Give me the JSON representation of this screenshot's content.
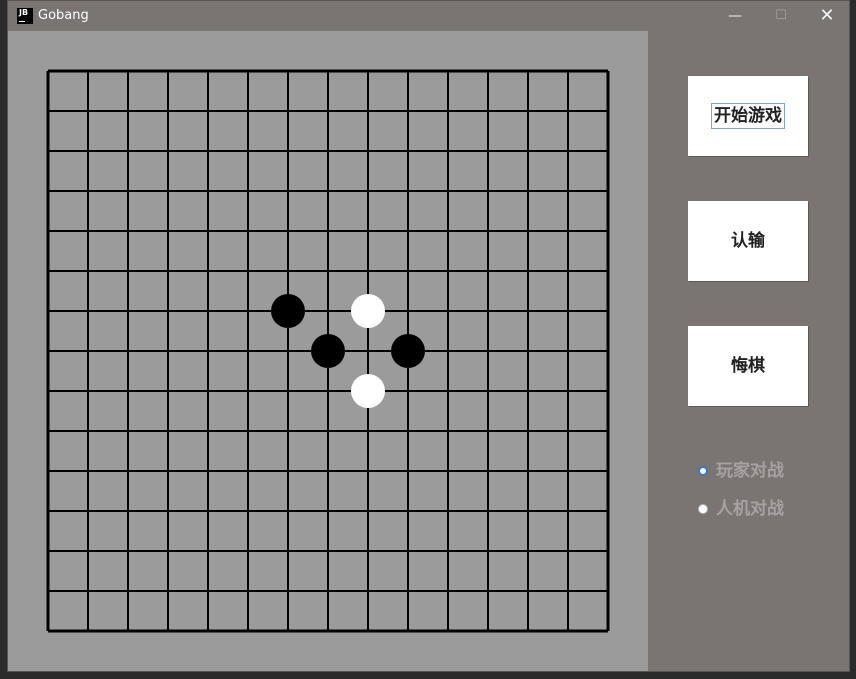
{
  "window": {
    "title": "Gobang",
    "icon": "JB",
    "minimize_glyph": "—",
    "maximize_glyph": "☐",
    "close_glyph": "✕"
  },
  "board": {
    "grid_cells": 14,
    "line_color": "#000000",
    "background_color": "#9b9b9b",
    "stones": [
      {
        "col": 6,
        "row": 6,
        "color": "black"
      },
      {
        "col": 8,
        "row": 6,
        "color": "white"
      },
      {
        "col": 7,
        "row": 7,
        "color": "black"
      },
      {
        "col": 9,
        "row": 7,
        "color": "black"
      },
      {
        "col": 8,
        "row": 8,
        "color": "white"
      }
    ]
  },
  "buttons": {
    "start": "开始游戏",
    "surrender": "认输",
    "undo": "悔棋"
  },
  "mode": {
    "options": [
      "玩家对战",
      "人机对战"
    ],
    "selected": "玩家对战"
  }
}
